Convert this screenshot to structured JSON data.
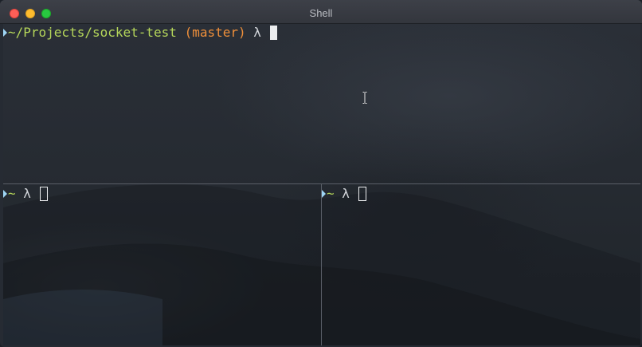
{
  "window": {
    "title": "Shell"
  },
  "panes": {
    "top": {
      "path": "~/Projects/socket-test",
      "branch": "(master)",
      "prompt_symbol": "λ"
    },
    "bottom_left": {
      "path": "~",
      "prompt_symbol": "λ"
    },
    "bottom_right": {
      "path": "~",
      "prompt_symbol": "λ"
    }
  },
  "colors": {
    "path": "#b5d65a",
    "branch": "#ef8f3a",
    "prompt": "#d3d6db",
    "marker": "#9fd6f5",
    "divider": "#5a5f68"
  },
  "icons": {
    "close": "close-button",
    "minimize": "minimize-button",
    "maximize": "maximize-button",
    "pointer": "text-cursor-ibeam-icon"
  }
}
